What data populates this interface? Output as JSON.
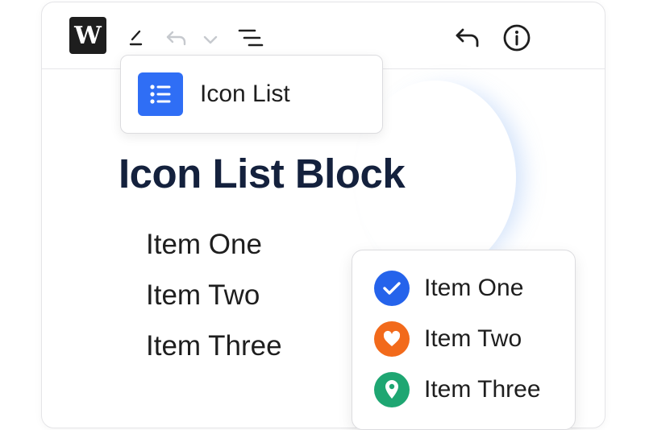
{
  "toolbar": {
    "logo_letter": "W",
    "icons": [
      "edit-pencil-icon",
      "undo-icon",
      "chevron-down-icon",
      "list-view-icon",
      "undo-arrow-icon",
      "info-icon"
    ]
  },
  "inserter": {
    "block_name": "Icon List",
    "block_icon": "list-icon",
    "block_icon_color": "#2f6ef5"
  },
  "content": {
    "heading": "Icon List Block",
    "items": [
      "Item One",
      "Item Two",
      "Item Three"
    ]
  },
  "preview": {
    "items": [
      {
        "label": "Item One",
        "icon": "check-icon",
        "color": "#2563eb"
      },
      {
        "label": "Item Two",
        "icon": "heart-icon",
        "color": "#f26a1b"
      },
      {
        "label": "Item Three",
        "icon": "map-pin-icon",
        "color": "#1ea672"
      }
    ]
  }
}
